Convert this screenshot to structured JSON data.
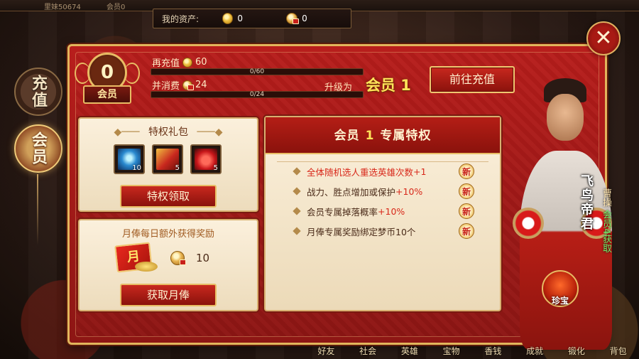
{
  "assets": {
    "label": "我的资产:",
    "gold": "0",
    "bound_gold": "0"
  },
  "vip": {
    "level": "0",
    "level_label": "会员"
  },
  "recharge": {
    "label": "再充值",
    "amount": "60",
    "progress_text": "0/60",
    "progress": 0
  },
  "consume": {
    "label": "并消费",
    "amount": "24",
    "progress_text": "0/24",
    "progress": 0
  },
  "upgrade": {
    "label": "升级为",
    "target": "会员 1"
  },
  "goto_recharge_label": "前往充值",
  "side_tabs": {
    "recharge": "充值",
    "member": "会员"
  },
  "gift": {
    "title": "特权礼包",
    "items": [
      {
        "icon": "skill-book-icon",
        "count": "10"
      },
      {
        "icon": "scroll-icon",
        "count": "5"
      },
      {
        "icon": "red-bag-icon",
        "count": "5"
      }
    ],
    "button": "特权领取"
  },
  "monthly": {
    "title": "月俸每日额外获得奖励",
    "icon_text": "月",
    "reward": "10",
    "button": "获取月俸"
  },
  "privileges": {
    "header_prefix": "会员",
    "header_num": "1",
    "header_suffix": "专属特权",
    "new_label": "新",
    "items": [
      {
        "text": "全体随机选人重选英雄次数",
        "plus": "+1",
        "highlight": true
      },
      {
        "text": "战力、胜点增加或保护",
        "plus": "+10%",
        "highlight": false
      },
      {
        "text": "会员专属掉落概率",
        "plus": "+10%",
        "highlight": false
      },
      {
        "text": "月俸专属奖励绑定梦币",
        "plus": "10个",
        "highlight": false
      }
    ]
  },
  "hero": {
    "name": "飞鸟帝君",
    "surname": "曹操",
    "unlock": "会员4获取"
  },
  "treasure_label": "珍宝",
  "bottom_tabs": [
    "好友",
    "社会",
    "英雄",
    "宝物",
    "香钱",
    "成就",
    "锻化",
    "背包"
  ],
  "top_strip": {
    "name": "里妹50674",
    "vip": "会员0"
  }
}
